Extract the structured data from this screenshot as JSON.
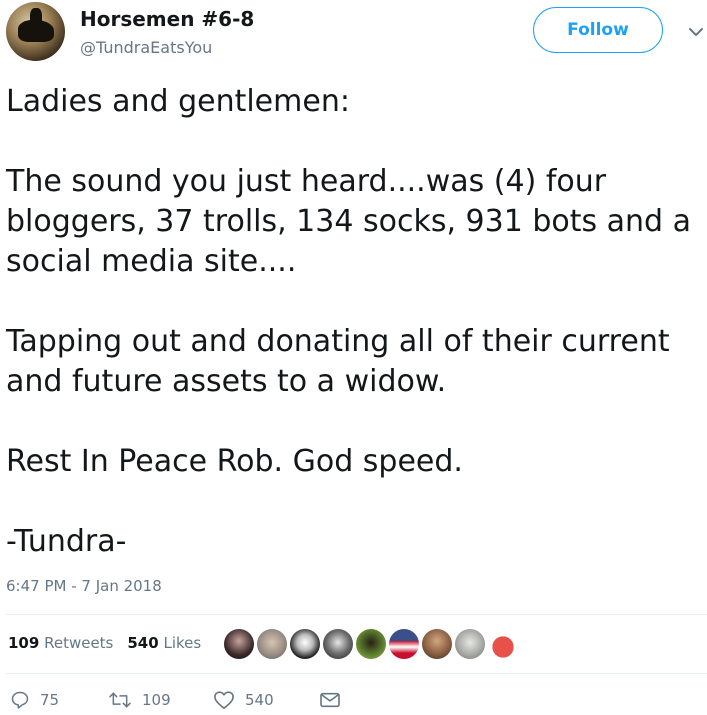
{
  "user": {
    "display_name": "Horsemen #6-8",
    "handle": "@TundraEatsYou"
  },
  "follow_label": "Follow",
  "tweet": {
    "text": "Ladies and gentlemen:\n\nThe sound you just heard....was (4) four bloggers, 37 trolls, 134 socks, 931 bots and a social media site....\n\nTapping out and donating all of their current and future assets to a widow.\n\nRest In Peace Rob. God speed.\n\n-Tundra-",
    "timestamp": "6:47 PM - 7 Jan 2018"
  },
  "stats": {
    "retweets_count": "109",
    "retweets_label": "Retweets",
    "likes_count": "540",
    "likes_label": "Likes"
  },
  "likers": [
    {
      "icon": "avatar-dark-woman",
      "color": "#3a2a2a"
    },
    {
      "icon": "avatar-woman-portrait",
      "color": "#9a8f86"
    },
    {
      "icon": "avatar-black-white-cartoon",
      "color": "#202020"
    },
    {
      "icon": "avatar-bw-face",
      "color": "#6e6e6e"
    },
    {
      "icon": "avatar-green-figure",
      "color": "#5c7d2e"
    },
    {
      "icon": "avatar-us-flag",
      "color": "#3b4f8a"
    },
    {
      "icon": "avatar-man-portrait",
      "color": "#8a5f43"
    },
    {
      "icon": "avatar-sketch-figure",
      "color": "#a8aaa6"
    },
    {
      "icon": "avatar-cartoon-red-cup",
      "color": "#e8514a"
    }
  ],
  "actions": {
    "reply_count": "75",
    "retweet_count": "109",
    "like_count": "540"
  },
  "colors": {
    "accent": "#1da1f2",
    "text": "#14171a",
    "muted": "#657786",
    "divider": "#e6ecf0"
  }
}
